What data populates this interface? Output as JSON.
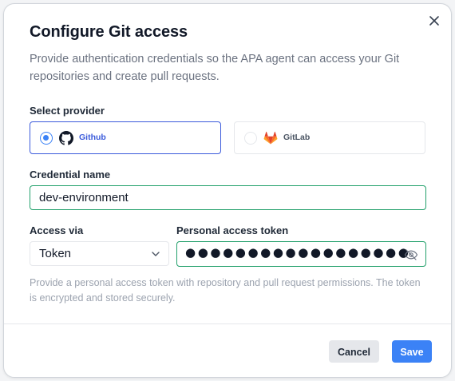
{
  "dialog": {
    "title": "Configure Git access",
    "subtitle": "Provide authentication credentials so the APA agent can access your Git repositories and create pull requests.",
    "close_icon": "close-icon"
  },
  "provider": {
    "label": "Select provider",
    "options": [
      {
        "name": "Github",
        "icon": "github-icon",
        "selected": true
      },
      {
        "name": "GitLab",
        "icon": "gitlab-icon",
        "selected": false
      }
    ]
  },
  "credential": {
    "label": "Credential name",
    "value": "dev-environment"
  },
  "access": {
    "label": "Access via",
    "value": "Token",
    "icon": "chevron-down-icon"
  },
  "token": {
    "label": "Personal access token",
    "masked_value": "●●●●●●●●●●●●●●●●●●",
    "icon": "eye-off-icon"
  },
  "help_text": "Provide a personal access token with repository and pull request permissions. The token is encrypted and stored securely.",
  "footer": {
    "cancel_label": "Cancel",
    "save_label": "Save"
  },
  "colors": {
    "accent": "#3b82f6",
    "selected_border": "#3b5bdb",
    "valid_border": "#22a06b",
    "gitlab_orange": "#e2432a"
  }
}
